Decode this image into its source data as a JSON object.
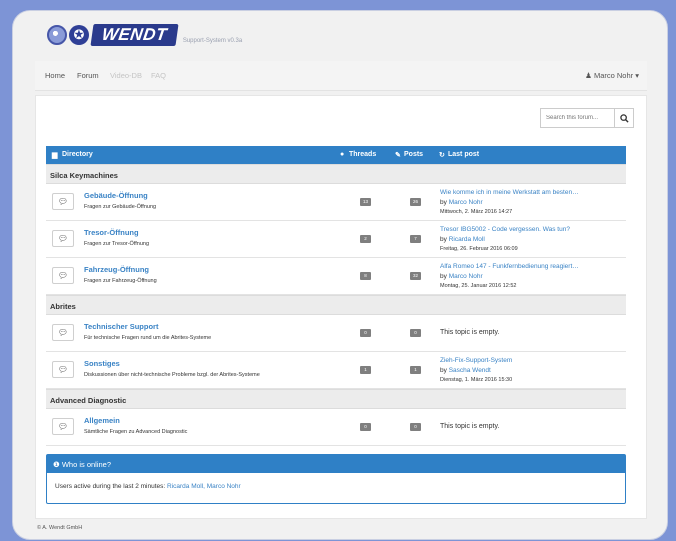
{
  "brand": {
    "name": "WENDT",
    "version": "Support-System v0.3a"
  },
  "nav": {
    "items": [
      {
        "label": "Home",
        "muted": false
      },
      {
        "label": "Forum",
        "muted": false
      },
      {
        "label": "Video-DB",
        "muted": true
      },
      {
        "label": "FAQ",
        "muted": true
      }
    ],
    "user": "Marco Nohr"
  },
  "search": {
    "placeholder": "Search this forum..."
  },
  "table": {
    "headers": {
      "directory": "Directory",
      "threads": "Threads",
      "posts": "Posts",
      "last": "Last post"
    },
    "categories": [
      {
        "name": "Silca Keymachines",
        "forums": [
          {
            "title": "Gebäude-Öffnung",
            "desc": "Fragen zur Gebäude-Öffnung",
            "threads": "13",
            "posts": "26",
            "last_title": "Wie komme ich in meine Werkstatt am besten…",
            "by": "by",
            "last_user": "Marco Nohr",
            "last_date": "Mittwoch, 2. März 2016 14:27"
          },
          {
            "title": "Tresor-Öffnung",
            "desc": "Fragen zur Tresor-Öffnung",
            "threads": "2",
            "posts": "7",
            "last_title": "Tresor IBG5002 - Code vergessen. Was tun?",
            "by": "by",
            "last_user": "Ricarda Moll",
            "last_date": "Freitag, 26. Februar 2016 06:09"
          },
          {
            "title": "Fahrzeug-Öffnung",
            "desc": "Fragen zur Fahrzeug-Öffnung",
            "threads": "8",
            "posts": "32",
            "last_title": "Alfa Romeo 147 - Funkfernbedienung reagiert…",
            "by": "by",
            "last_user": "Marco Nohr",
            "last_date": "Montag, 25. Januar 2016 12:52"
          }
        ]
      },
      {
        "name": "Abrites",
        "forums": [
          {
            "title": "Technischer Support",
            "desc": "Für technische Fragen rund um die Abrites-Systeme",
            "threads": "0",
            "posts": "0",
            "empty": "This topic is empty."
          },
          {
            "title": "Sonstiges",
            "desc": "Diskussionen über nicht-technische Probleme bzgl. der Abrites-Systeme",
            "threads": "1",
            "posts": "1",
            "last_title": "Zieh-Fix-Support-System",
            "by": "by",
            "last_user": "Sascha Wendt",
            "last_date": "Dienstag, 1. März 2016 15:30"
          }
        ]
      },
      {
        "name": "Advanced Diagnostic",
        "forums": [
          {
            "title": "Allgemein",
            "desc": "Sämtliche Fragen zu Advanced Diagnostic",
            "threads": "0",
            "posts": "0",
            "empty": "This topic is empty."
          }
        ]
      }
    ]
  },
  "online": {
    "title": "Who is online?",
    "text": "Users active during the last 2 minutes:",
    "users": "Ricarda Moll, Marco Nohr"
  },
  "footer": "© A. Wendt GmbH"
}
